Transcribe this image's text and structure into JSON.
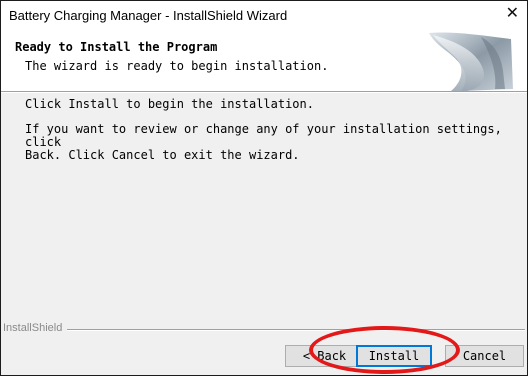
{
  "window": {
    "title": "Battery Charging Manager - InstallShield Wizard",
    "close_glyph": "✕"
  },
  "header": {
    "title": "Ready to Install the Program",
    "subtitle": "The wizard is ready to begin installation.",
    "art_icon": "installshield-banner-art"
  },
  "body": {
    "line1": "Click Install to begin the installation.",
    "line2": "If you want to review or change any of your installation settings, click\nBack. Click Cancel to exit the wizard."
  },
  "footer": {
    "brand": "InstallShield"
  },
  "buttons": {
    "back_label": "< Back",
    "install_label": "Install",
    "cancel_label": "Cancel"
  },
  "colors": {
    "highlight": "#e31818",
    "focus": "#0078d7"
  }
}
